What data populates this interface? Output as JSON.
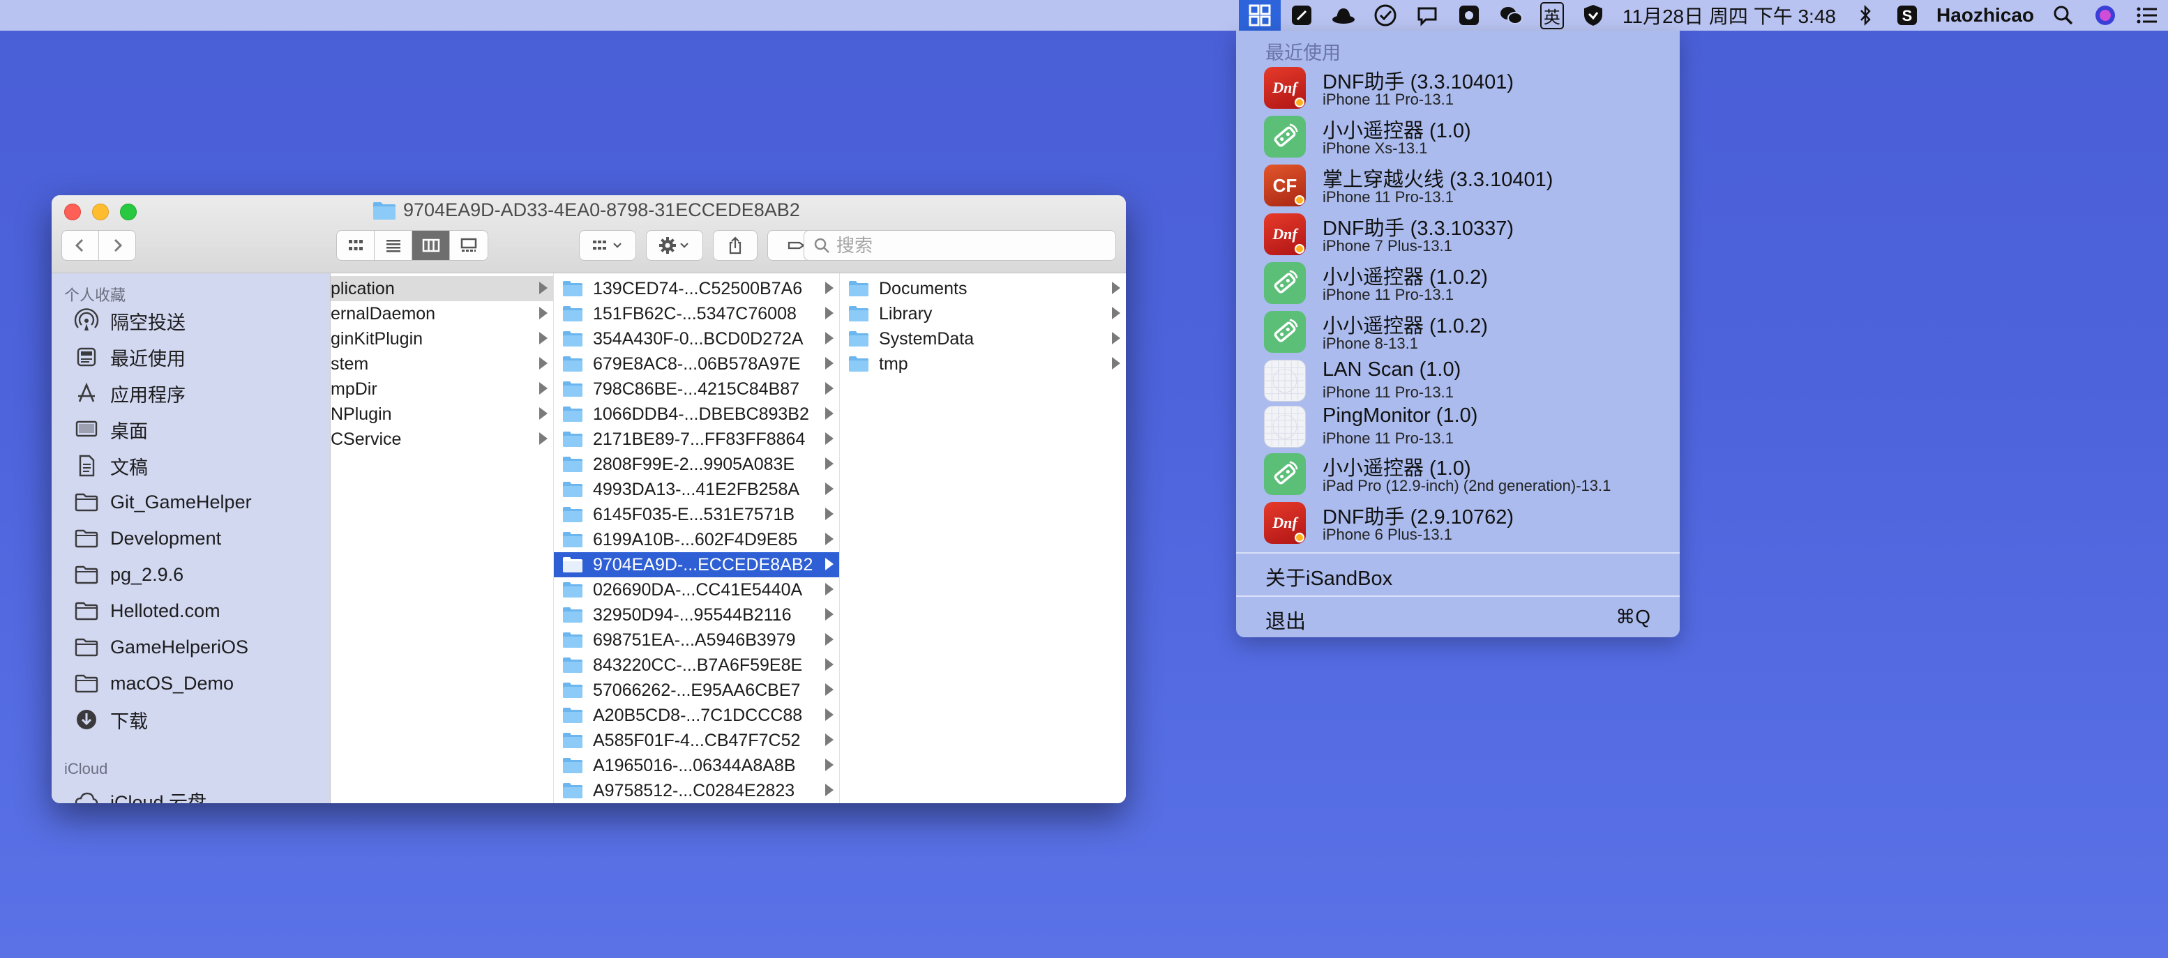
{
  "menubar": {
    "datetime": "11月28日 周四 下午 3:48",
    "username": "Haozhicao",
    "ime_label": "英"
  },
  "sandbox_menu": {
    "header": "最近使用",
    "apps": [
      {
        "name": "DNF助手 (3.3.10401)",
        "device": "iPhone 11 Pro-13.1",
        "icon": "dnf-app-icon"
      },
      {
        "name": "小小遥控器 (1.0)",
        "device": "iPhone Xs-13.1",
        "icon": "remote-app-icon"
      },
      {
        "name": "掌上穿越火线 (3.3.10401)",
        "device": "iPhone 11 Pro-13.1",
        "icon": "crossfire-app-icon"
      },
      {
        "name": "DNF助手 (3.3.10337)",
        "device": "iPhone 7 Plus-13.1",
        "icon": "dnf-app-icon"
      },
      {
        "name": "小小遥控器 (1.0.2)",
        "device": "iPhone 11 Pro-13.1",
        "icon": "remote-app-icon"
      },
      {
        "name": "小小遥控器 (1.0.2)",
        "device": "iPhone 8-13.1",
        "icon": "remote-app-icon"
      },
      {
        "name": "LAN Scan (1.0)",
        "device": "iPhone 11 Pro-13.1",
        "icon": "blank-app-icon"
      },
      {
        "name": "PingMonitor (1.0)",
        "device": "iPhone 11 Pro-13.1",
        "icon": "blank-app-icon"
      },
      {
        "name": "小小遥控器 (1.0)",
        "device": "iPad Pro (12.9-inch) (2nd generation)-13.1",
        "icon": "remote-app-icon"
      },
      {
        "name": "DNF助手 (2.9.10762)",
        "device": "iPhone 6 Plus-13.1",
        "icon": "dnf-app-icon"
      }
    ],
    "about_label": "关于iSandBox",
    "quit_label": "退出",
    "quit_shortcut": "⌘Q"
  },
  "finder": {
    "title": "9704EA9D-AD33-4EA0-8798-31ECCEDE8AB2",
    "search_placeholder": "搜索",
    "sidebar": {
      "favorites_header": "个人收藏",
      "items": [
        {
          "label": "隔空投送",
          "icon": "airdrop-icon"
        },
        {
          "label": "最近使用",
          "icon": "recents-icon"
        },
        {
          "label": "应用程序",
          "icon": "applications-icon"
        },
        {
          "label": "桌面",
          "icon": "desktop-icon"
        },
        {
          "label": "文稿",
          "icon": "documents-icon"
        },
        {
          "label": "Git_GameHelper",
          "icon": "folder-icon"
        },
        {
          "label": "Development",
          "icon": "folder-icon"
        },
        {
          "label": "pg_2.9.6",
          "icon": "folder-icon"
        },
        {
          "label": "Helloted.com",
          "icon": "folder-icon"
        },
        {
          "label": "GameHelperiOS",
          "icon": "folder-icon"
        },
        {
          "label": "macOS_Demo",
          "icon": "folder-icon"
        },
        {
          "label": "下载",
          "icon": "downloads-icon"
        }
      ],
      "icloud_header": "iCloud",
      "icloud_items": [
        {
          "label": "iCloud 云盘",
          "icon": "cloud-icon"
        }
      ]
    },
    "column1": [
      "plication",
      "ernalDaemon",
      "ginKitPlugin",
      "stem",
      "mpDir",
      "NPlugin",
      "CService"
    ],
    "column2": [
      "139CED74-...C52500B7A6",
      "151FB62C-...5347C76008",
      "354A430F-0...BCD0D272A",
      "679E8AC8-...06B578A97E",
      "798C86BE-...4215C84B87",
      "1066DDB4-...DBEBC893B2",
      "2171BE89-7...FF83FF8864",
      "2808F99E-2...9905A083E",
      "4993DA13-...41E2FB258A",
      "6145F035-E...531E7571B",
      "6199A10B-...602F4D9E85",
      "9704EA9D-...ECCEDE8AB2",
      "026690DA-...CC41E5440A",
      "32950D94-...95544B2116",
      "698751EA-...A5946B3979",
      "843220CC-...B7A6F59E8E",
      "57066262-...E95AA6CBE7",
      "A20B5CD8-...7C1DCCC88",
      "A585F01F-4...CB47F7C52",
      "A1965016-...06344A8A8B",
      "A9758512-...C0284E2823"
    ],
    "column2_selected_index": 11,
    "column3": [
      "Documents",
      "Library",
      "SystemData",
      "tmp"
    ]
  },
  "colors": {
    "selection": "#2e5fd4",
    "folder": "#6cb6ef",
    "menu_highlight": "#2d64db"
  }
}
